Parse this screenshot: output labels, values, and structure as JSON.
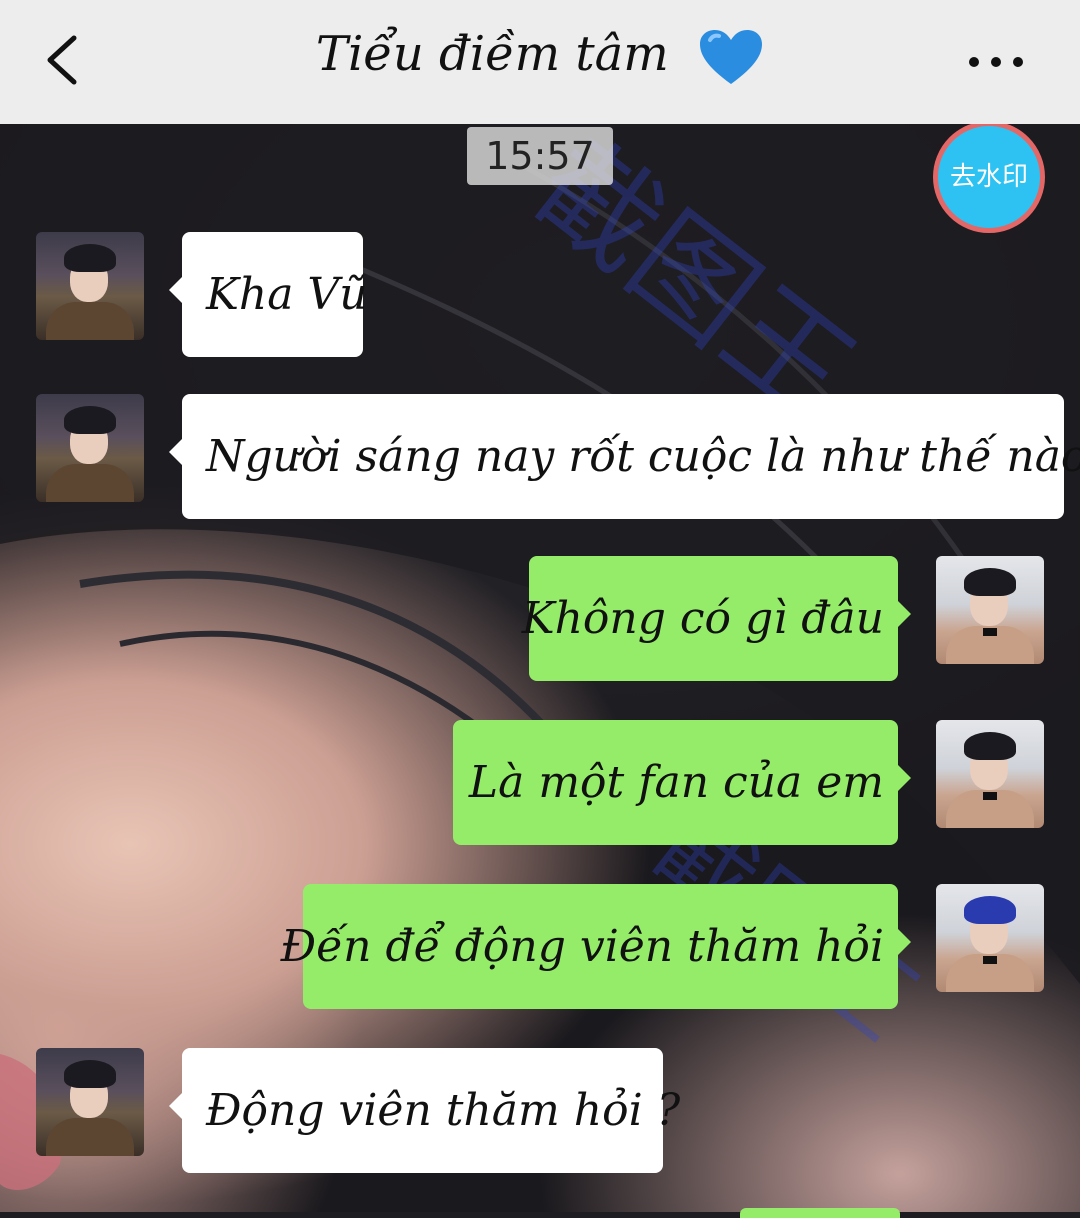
{
  "header": {
    "title": "Tiểu điềm tâm",
    "title_emoji": "💙",
    "back_icon": "chevron-left-icon",
    "more_icon": "ellipsis-icon"
  },
  "chat": {
    "timestamp": "15:57",
    "remove_watermark_label": "去水印",
    "watermark_text": "截图王",
    "messages": [
      {
        "side": "left",
        "text": "Kha Vũ"
      },
      {
        "side": "left",
        "text": "Người sáng nay rốt cuộc là như thế nào vậy"
      },
      {
        "side": "right",
        "text": "Không có gì đâu"
      },
      {
        "side": "right",
        "text": "Là một fan của em"
      },
      {
        "side": "right",
        "text": "Đến để động viên thăm hỏi"
      },
      {
        "side": "left",
        "text": "Động viên thăm hỏi ?"
      }
    ]
  },
  "colors": {
    "header_bg": "#ededed",
    "green_bubble": "#95ec69",
    "white_bubble": "#ffffff",
    "watermark_button": "#2ec2f2",
    "watermark_button_border": "#e36767"
  }
}
